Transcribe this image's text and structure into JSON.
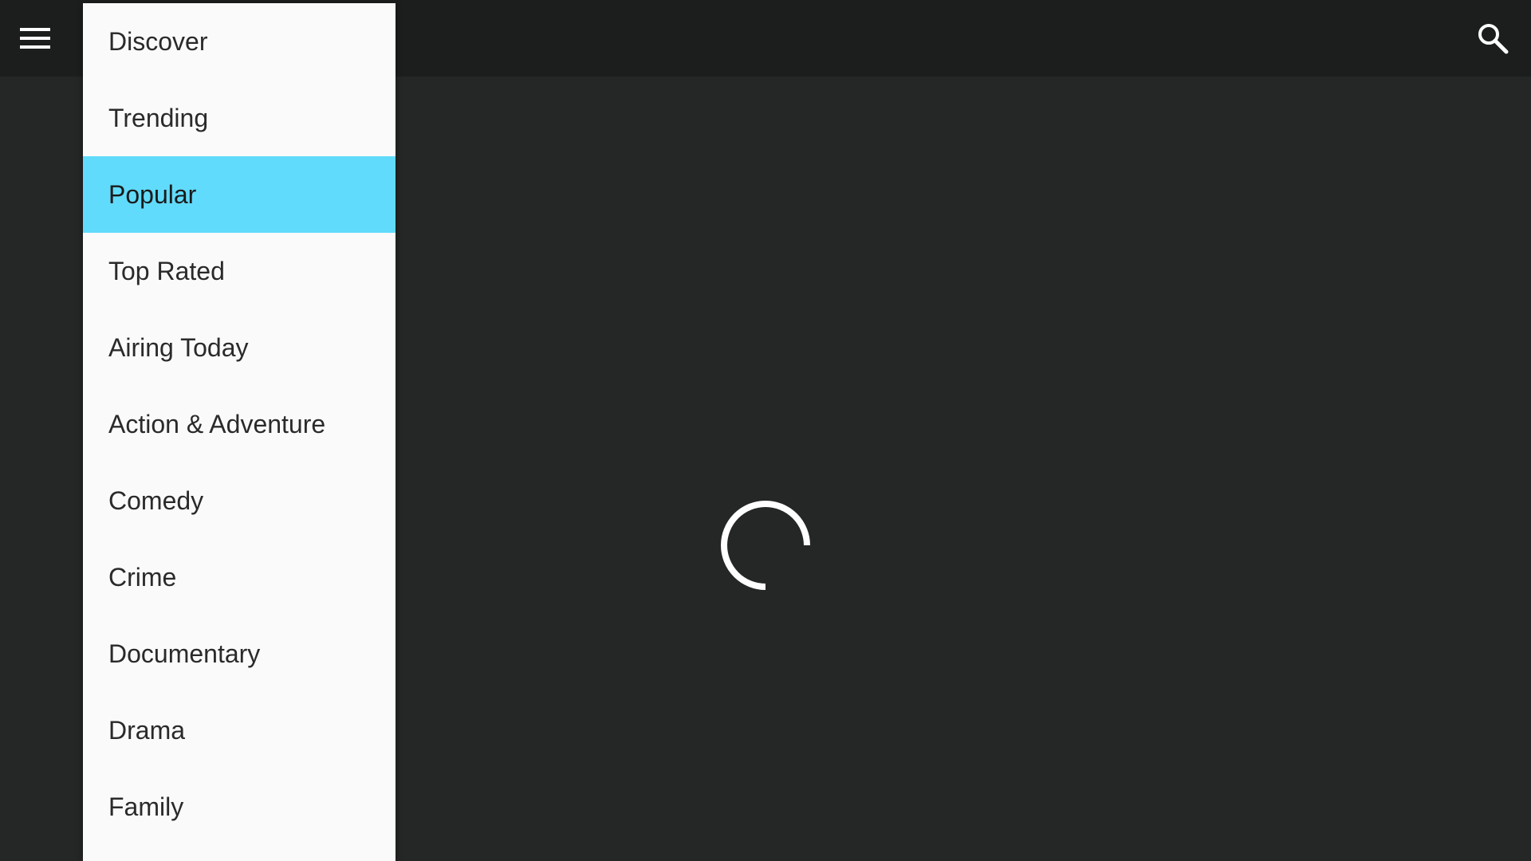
{
  "topbar": {
    "menu_icon": "hamburger-menu-icon",
    "search_icon": "search-icon"
  },
  "content": {
    "loading_indicator": "loading-spinner-icon"
  },
  "dropdown": {
    "selected": "Popular",
    "items": [
      {
        "label": "Discover",
        "selected": false
      },
      {
        "label": "Trending",
        "selected": false
      },
      {
        "label": "Popular",
        "selected": true
      },
      {
        "label": "Top Rated",
        "selected": false
      },
      {
        "label": "Airing Today",
        "selected": false
      },
      {
        "label": "Action & Adventure",
        "selected": false
      },
      {
        "label": "Comedy",
        "selected": false
      },
      {
        "label": "Crime",
        "selected": false
      },
      {
        "label": "Documentary",
        "selected": false
      },
      {
        "label": "Drama",
        "selected": false
      },
      {
        "label": "Family",
        "selected": false
      }
    ]
  },
  "colors": {
    "background": "#242725",
    "topbar": "#1c1e1e",
    "dropdown_background": "#fafafa",
    "selected_highlight": "#61dbfb",
    "icon": "#ffffff"
  }
}
